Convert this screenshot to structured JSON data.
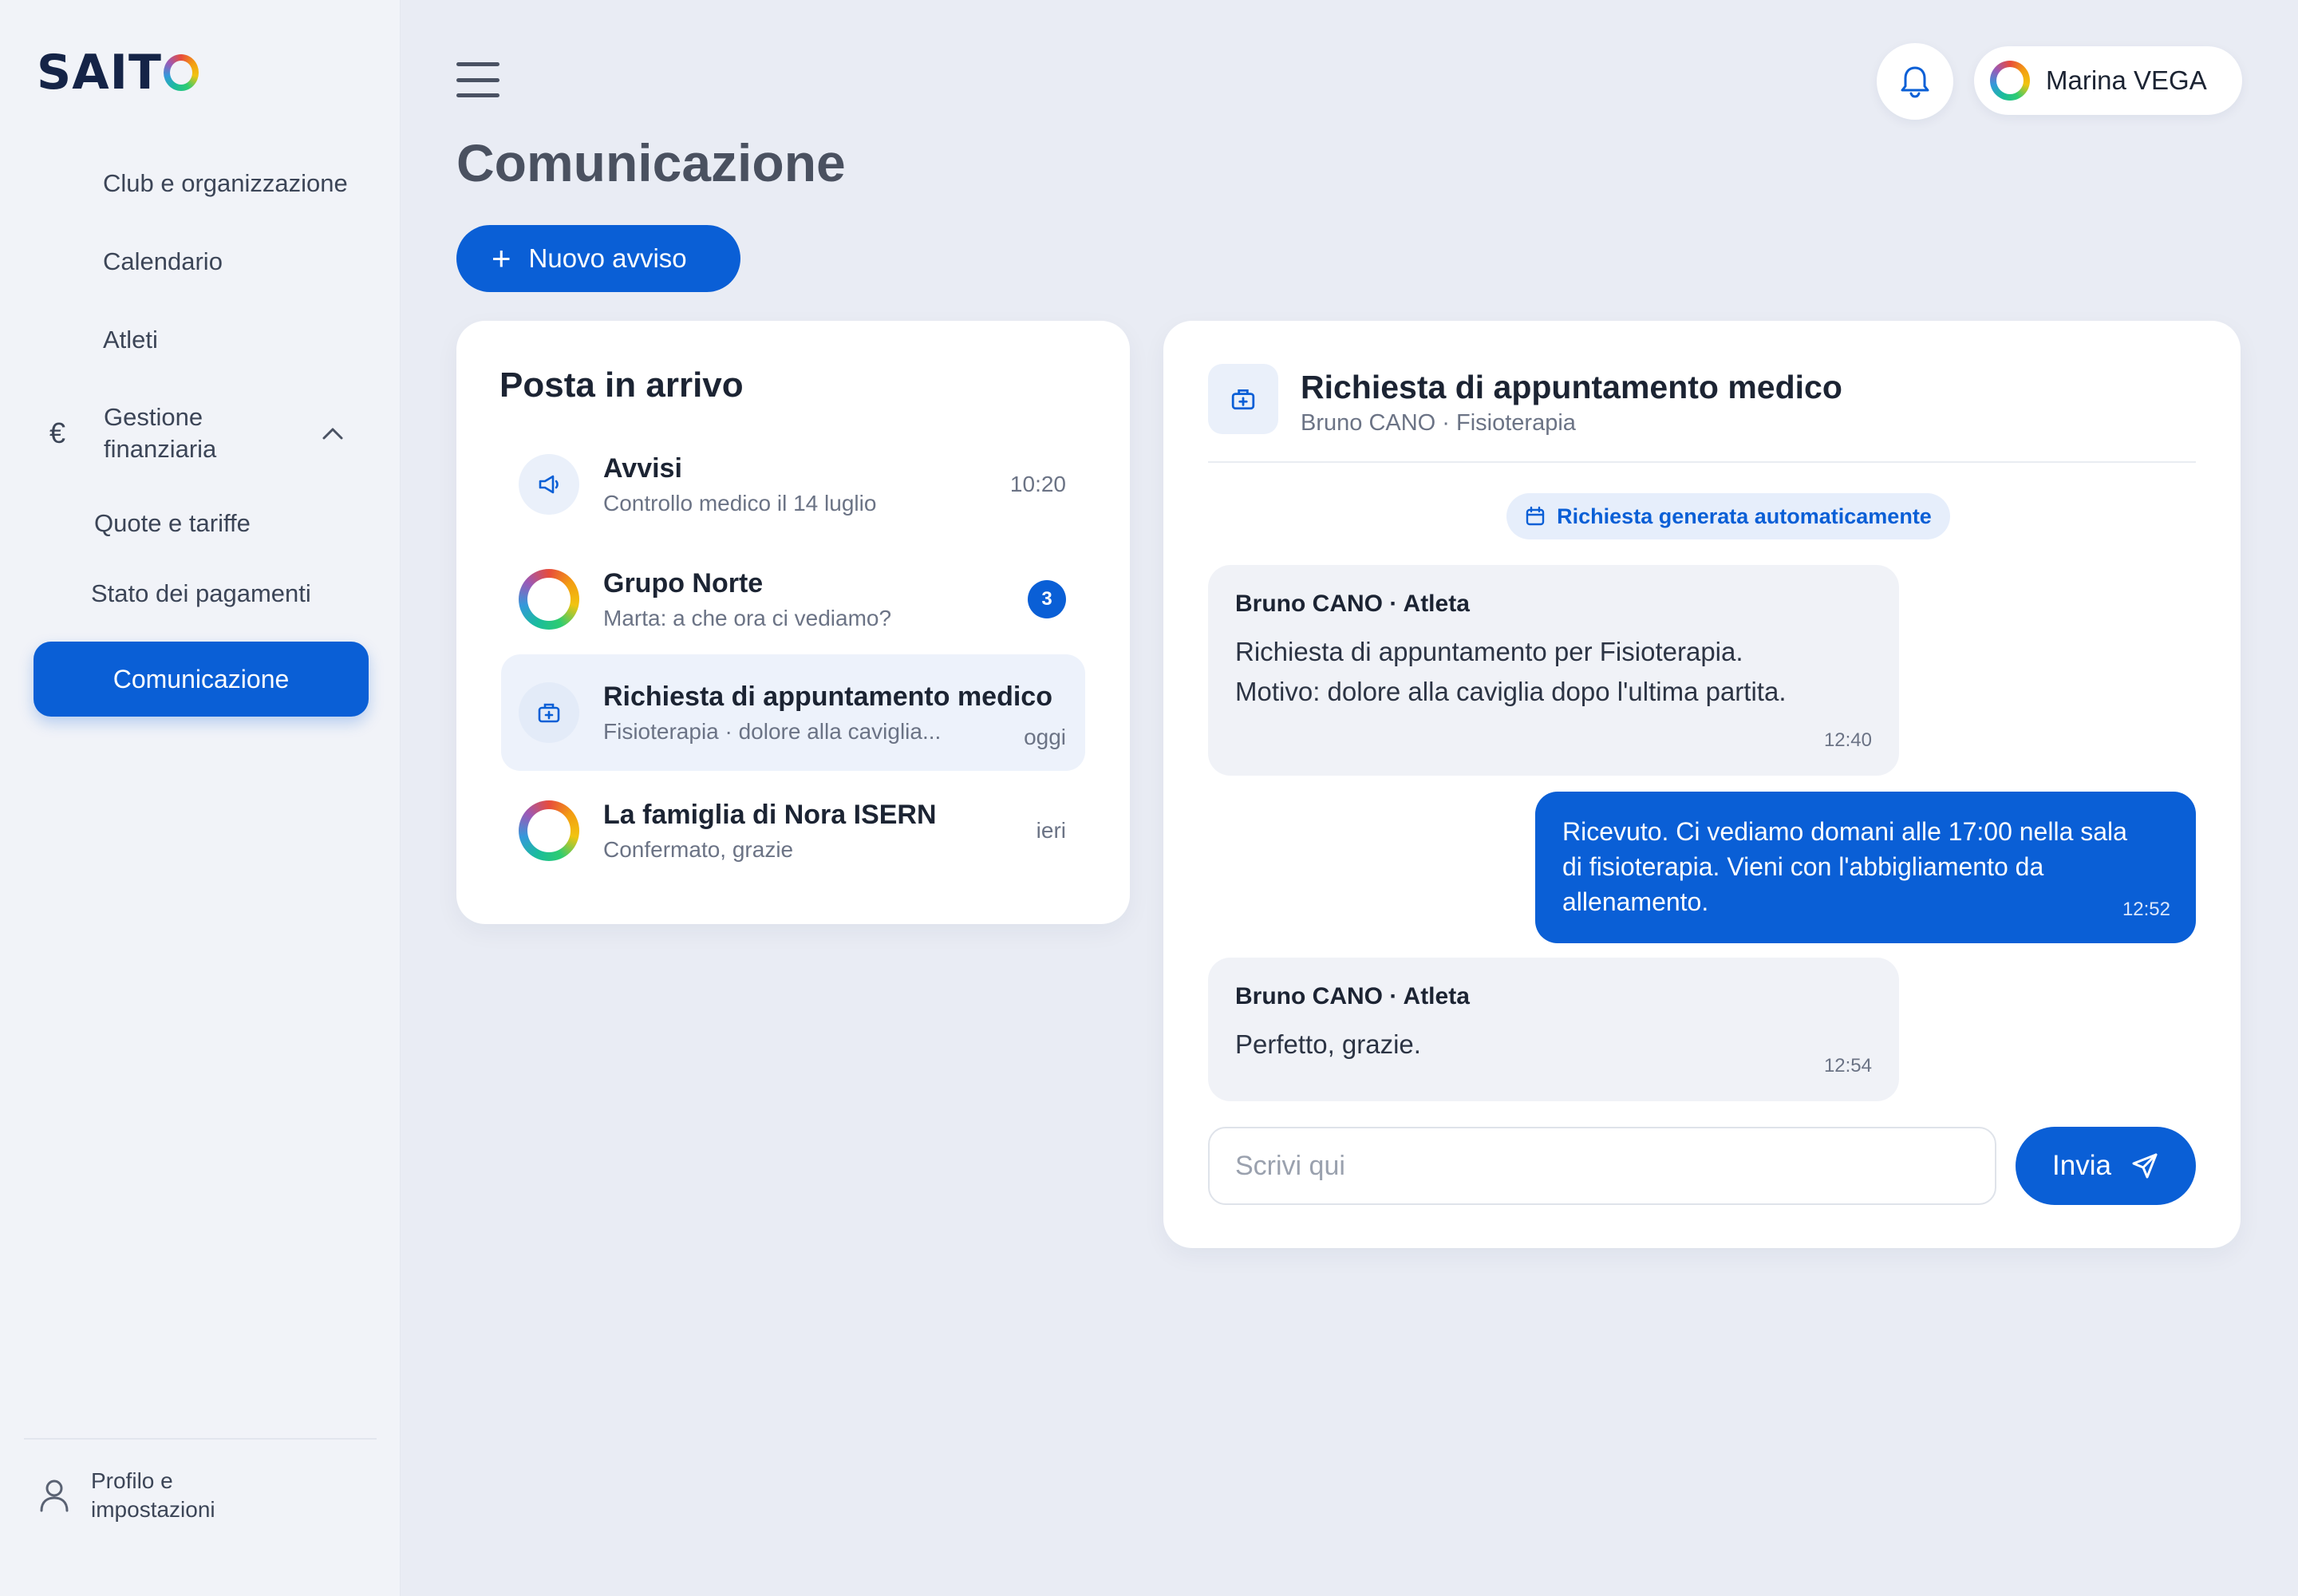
{
  "app": {
    "logo": "SAITO"
  },
  "sidebar": {
    "items": [
      {
        "label": "Club e organizzazione"
      },
      {
        "label": "Calendario"
      },
      {
        "label": "Atleti"
      }
    ],
    "group": {
      "label": "Gestione finanziaria",
      "icon": "euro-icon",
      "expanded": true
    },
    "sub_items": [
      {
        "label": "Quote e tariffe"
      },
      {
        "label": "Stato dei pagamenti"
      }
    ],
    "active": {
      "label": "Comunicazione"
    },
    "footer": {
      "label": "Profilo e impostazioni"
    }
  },
  "header": {
    "user_name": "Marina VEGA"
  },
  "page": {
    "title": "Comunicazione",
    "new_button": "Nuovo avviso"
  },
  "inbox": {
    "title": "Posta in arrivo",
    "conversations": [
      {
        "title": "Avvisi",
        "subtitle": "Controllo medico il 14 luglio",
        "meta": "10:20",
        "icon": "megaphone-icon"
      },
      {
        "title": "Grupo Norte",
        "subtitle": "Marta: a che ora ci vediamo?",
        "badge": "3",
        "icon": "group-avatar"
      },
      {
        "title": "Richiesta di appuntamento medico",
        "subtitle": "Fisioterapia · dolore alla caviglia...",
        "meta": "oggi",
        "icon": "medical-kit-icon",
        "selected": true
      },
      {
        "title": "La famiglia di Nora ISERN",
        "subtitle": "Confermato, grazie",
        "meta": "ieri",
        "icon": "family-avatar"
      }
    ]
  },
  "chat": {
    "title": "Richiesta di appuntamento medico",
    "subtitle": "Bruno CANO · Fisioterapia",
    "system_note": "Richiesta generata automaticamente",
    "messages": [
      {
        "sender": "Bruno CANO · Atleta",
        "line1": "Richiesta di appuntamento per Fisioterapia.",
        "line2": "Motivo: dolore alla caviglia dopo l'ultima partita.",
        "time": "12:40"
      },
      {
        "text": "Ricevuto. Ci vediamo domani alle 17:00 nella sala di fisioterapia. Vieni con l'abbigliamento da allenamento.",
        "time": "12:52"
      },
      {
        "sender": "Bruno CANO · Atleta",
        "line1": "Perfetto, grazie.",
        "time": "12:54"
      }
    ],
    "composer_placeholder": "Scrivi qui",
    "send_label": "Invia"
  },
  "colors": {
    "accent": "#0a5fd6",
    "background": "#e9ecf4",
    "sidebar": "#f1f3f8"
  }
}
